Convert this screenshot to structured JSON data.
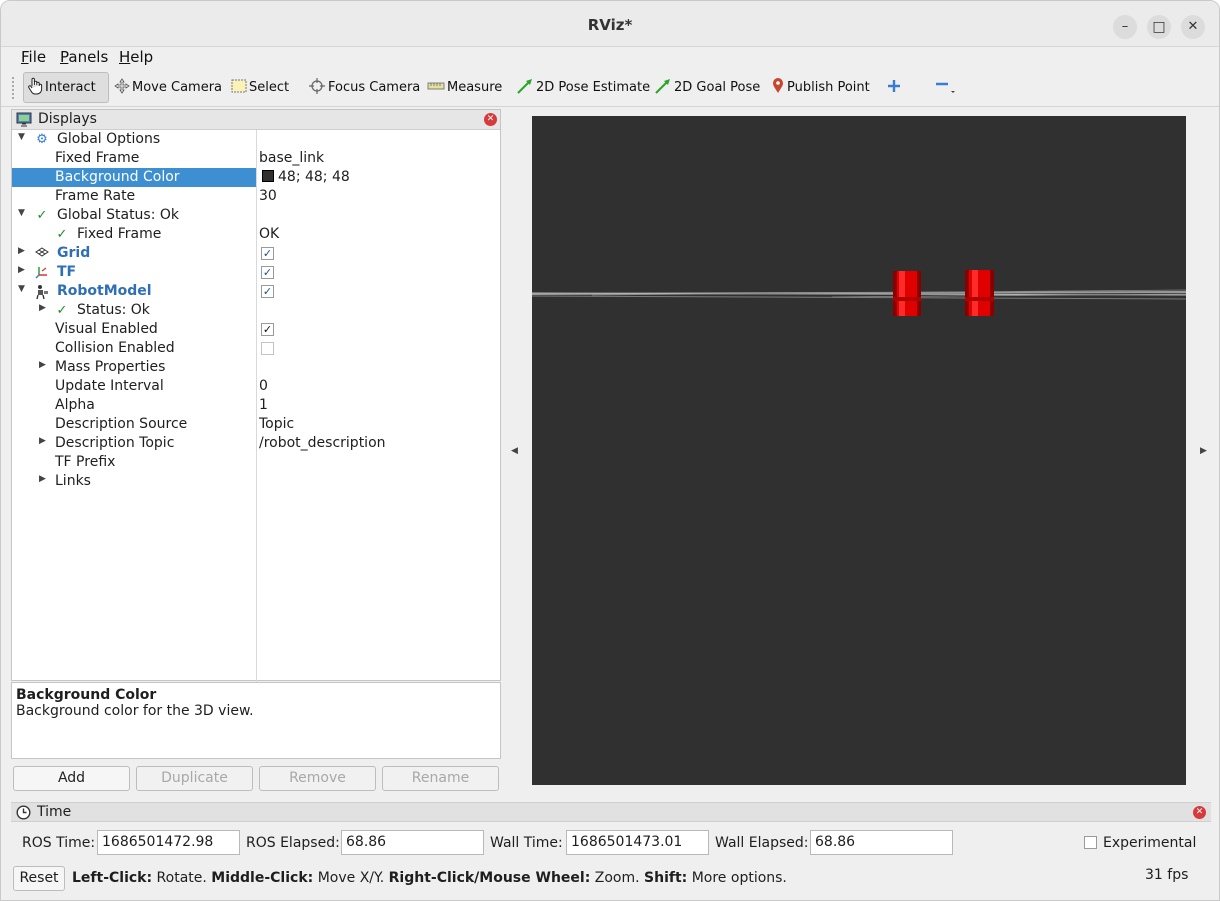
{
  "window": {
    "title": "RViz*",
    "controls": {
      "minimize": "–",
      "maximize": "□",
      "close": "✕"
    }
  },
  "menubar": {
    "items": [
      {
        "label": "File",
        "underline": "F",
        "rest": "ile"
      },
      {
        "label": "Panels",
        "underline": "P",
        "rest": "anels"
      },
      {
        "label": "Help",
        "underline": "H",
        "rest": "elp"
      }
    ]
  },
  "toolbar": {
    "tools": [
      {
        "label": "Interact",
        "icon": "hand-icon",
        "active": true
      },
      {
        "label": "Move Camera",
        "icon": "move-camera-icon"
      },
      {
        "label": "Select",
        "icon": "select-icon"
      },
      {
        "label": "Focus Camera",
        "icon": "focus-camera-icon"
      },
      {
        "label": "Measure",
        "icon": "ruler-icon"
      },
      {
        "label": "2D Pose Estimate",
        "icon": "green-arrow-icon"
      },
      {
        "label": "2D Goal Pose",
        "icon": "green-arrow-icon"
      },
      {
        "label": "Publish Point",
        "icon": "map-pin-icon"
      }
    ],
    "add_tool_icon": "plus-icon",
    "remove_tool_icon": "minus-icon"
  },
  "displays": {
    "title": "Displays",
    "rows": [
      {
        "label": "Global Options",
        "value": "",
        "icon": "gear-icon"
      },
      {
        "label": "Fixed Frame",
        "value": "base_link"
      },
      {
        "label": "Background Color",
        "value": "48; 48; 48",
        "selected": true
      },
      {
        "label": "Frame Rate",
        "value": "30"
      },
      {
        "label": "Global Status: Ok",
        "value": ""
      },
      {
        "label": "Fixed Frame",
        "value": "OK"
      },
      {
        "label": "Grid",
        "value": ""
      },
      {
        "label": "TF",
        "value": ""
      },
      {
        "label": "RobotModel",
        "value": ""
      },
      {
        "label": "Status: Ok",
        "value": ""
      },
      {
        "label": "Visual Enabled",
        "value": ""
      },
      {
        "label": "Collision Enabled",
        "value": ""
      },
      {
        "label": "Mass Properties",
        "value": ""
      },
      {
        "label": "Update Interval",
        "value": "0"
      },
      {
        "label": "Alpha",
        "value": "1"
      },
      {
        "label": "Description Source",
        "value": "Topic"
      },
      {
        "label": "Description Topic",
        "value": "/robot_description"
      },
      {
        "label": "TF Prefix",
        "value": ""
      },
      {
        "label": "Links",
        "value": ""
      }
    ],
    "checks": {
      "grid": true,
      "tf": true,
      "robotmodel": true,
      "visual_enabled": true,
      "collision_enabled": false
    },
    "background_swatch": "#303030",
    "description": {
      "title": "Background Color",
      "text": "Background color for the 3D view."
    },
    "buttons": {
      "add": "Add",
      "duplicate": "Duplicate",
      "remove": "Remove",
      "rename": "Rename"
    }
  },
  "view3d": {
    "background": "#303030",
    "object_color": "#e00000"
  },
  "time": {
    "title": "Time",
    "ros_time_label": "ROS Time:",
    "ros_time": "1686501472.98",
    "ros_elapsed_label": "ROS Elapsed:",
    "ros_elapsed": "68.86",
    "wall_time_label": "Wall Time:",
    "wall_time": "1686501473.01",
    "wall_elapsed_label": "Wall Elapsed:",
    "wall_elapsed": "68.86",
    "experimental_label": "Experimental",
    "experimental_checked": false
  },
  "statusbar": {
    "reset": "Reset",
    "hint_parts": [
      {
        "b": "Left-Click:",
        "t": " Rotate. "
      },
      {
        "b": "Middle-Click:",
        "t": " Move X/Y. "
      },
      {
        "b": "Right-Click/Mouse Wheel:",
        "t": " Zoom. "
      },
      {
        "b": "Shift:",
        "t": " More options."
      }
    ],
    "fps": "31 fps"
  }
}
